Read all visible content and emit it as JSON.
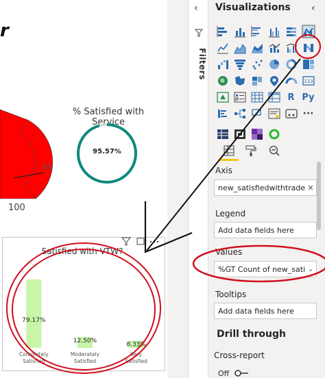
{
  "canvas": {
    "title_fragment": "r",
    "gauge": {
      "mark_label": "85",
      "max_label": "100",
      "fill_color": "#ff0000"
    },
    "donut": {
      "title": "% Satisfied with Service",
      "value_label": "95.57%",
      "value": 95.57,
      "color": "#0e8a7e"
    },
    "selected_visual": {
      "title": "Satisfied with VTW?",
      "chart_data": {
        "type": "bar",
        "categories": [
          "Completely Satisfied",
          "Moderately Satisfied",
          "Very Satisfied"
        ],
        "values": [
          79.17,
          12.5,
          8.33
        ],
        "data_labels": [
          "79.17%",
          "12.50%",
          "8.33%"
        ],
        "bar_color": "#c8f5a8",
        "ylim": [
          0,
          100
        ]
      }
    }
  },
  "filters_pane": {
    "label": "Filters",
    "collapse_glyph": "‹"
  },
  "visualizations_pane": {
    "title": "Visualizations",
    "collapse_glyph": "‹",
    "text_icons": {
      "r": "R",
      "py": "Py",
      "more": "···"
    },
    "wells": {
      "axis": {
        "label": "Axis",
        "value": "new_satisfiedwithtradein"
      },
      "legend": {
        "label": "Legend",
        "placeholder": "Add data fields here"
      },
      "values": {
        "label": "Values",
        "value": "%GT Count of new_satisfie"
      },
      "tooltips": {
        "label": "Tooltips",
        "placeholder": "Add data fields here"
      }
    },
    "drill_through": {
      "title": "Drill through",
      "cross_report_label": "Cross-report",
      "toggle_state": "Off"
    }
  },
  "annotation_color": "#d0101e"
}
